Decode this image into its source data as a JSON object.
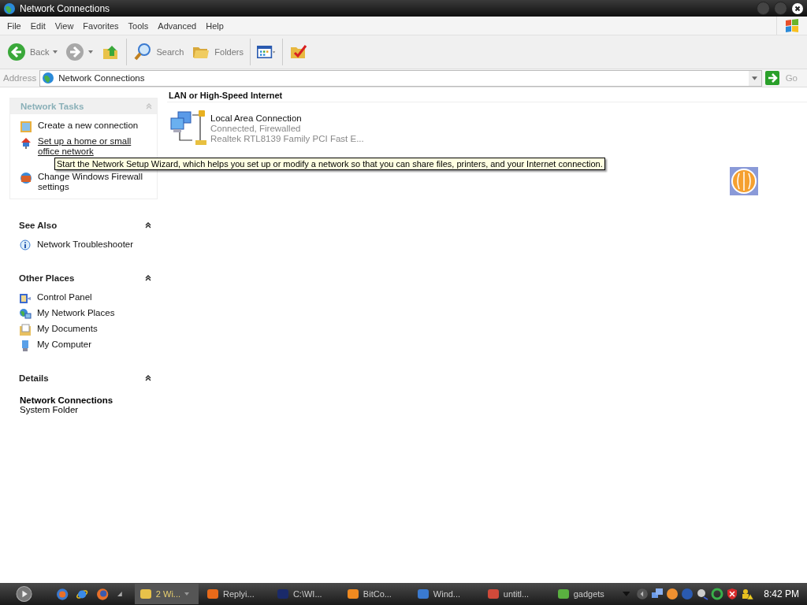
{
  "window": {
    "title": "Network Connections"
  },
  "menu": [
    "File",
    "Edit",
    "View",
    "Favorites",
    "Tools",
    "Advanced",
    "Help"
  ],
  "toolbar": [
    {
      "kind": "back",
      "label": "Back"
    },
    {
      "kind": "forward"
    },
    {
      "kind": "up"
    },
    {
      "kind": "search",
      "label": "Search"
    },
    {
      "kind": "folders",
      "label": "Folders"
    },
    {
      "kind": "views"
    },
    {
      "kind": "sync"
    }
  ],
  "address": {
    "label": "Address",
    "value": "Network Connections",
    "go": "Go"
  },
  "sidebar": [
    {
      "kind": "tasks",
      "title": "Network Tasks",
      "items": [
        {
          "text": "Create a new connection",
          "underlined": false
        },
        {
          "text": "Set up a home or small office network",
          "underlined": true
        },
        {
          "text": "Change Windows Firewall settings",
          "underlined": false
        }
      ]
    },
    {
      "kind": "links",
      "title": "See Also",
      "items": [
        {
          "text": "Network Troubleshooter",
          "underlined": false
        }
      ]
    },
    {
      "kind": "links",
      "title": "Other Places",
      "items": [
        {
          "text": "Control Panel",
          "underlined": false
        },
        {
          "text": "My Network Places",
          "underlined": false
        },
        {
          "text": "My Documents",
          "underlined": false
        },
        {
          "text": "My Computer",
          "underlined": false
        }
      ]
    },
    {
      "kind": "details",
      "title": "Details",
      "name": "Network Connections",
      "type": "System Folder"
    }
  ],
  "group": {
    "title": "LAN or High-Speed Internet",
    "connections": [
      {
        "name": "Local Area Connection",
        "status": "Connected, Firewalled",
        "device": "Realtek RTL8139 Family PCI Fast E..."
      }
    ]
  },
  "tooltip": "Start the Network Setup Wizard, which helps you set up or modify a network so that you can share files, printers, and your Internet connection.",
  "taskbar": {
    "tasks": [
      {
        "label": "2 Wi...",
        "selected": true
      },
      {
        "label": "Replyi...",
        "selected": false
      },
      {
        "label": "C:\\WI...",
        "selected": false
      },
      {
        "label": "BitCo...",
        "selected": false
      },
      {
        "label": "Wind...",
        "selected": false
      },
      {
        "label": "untitl...",
        "selected": false
      },
      {
        "label": "gadgets",
        "selected": false
      }
    ],
    "clock": "8:42 PM"
  }
}
